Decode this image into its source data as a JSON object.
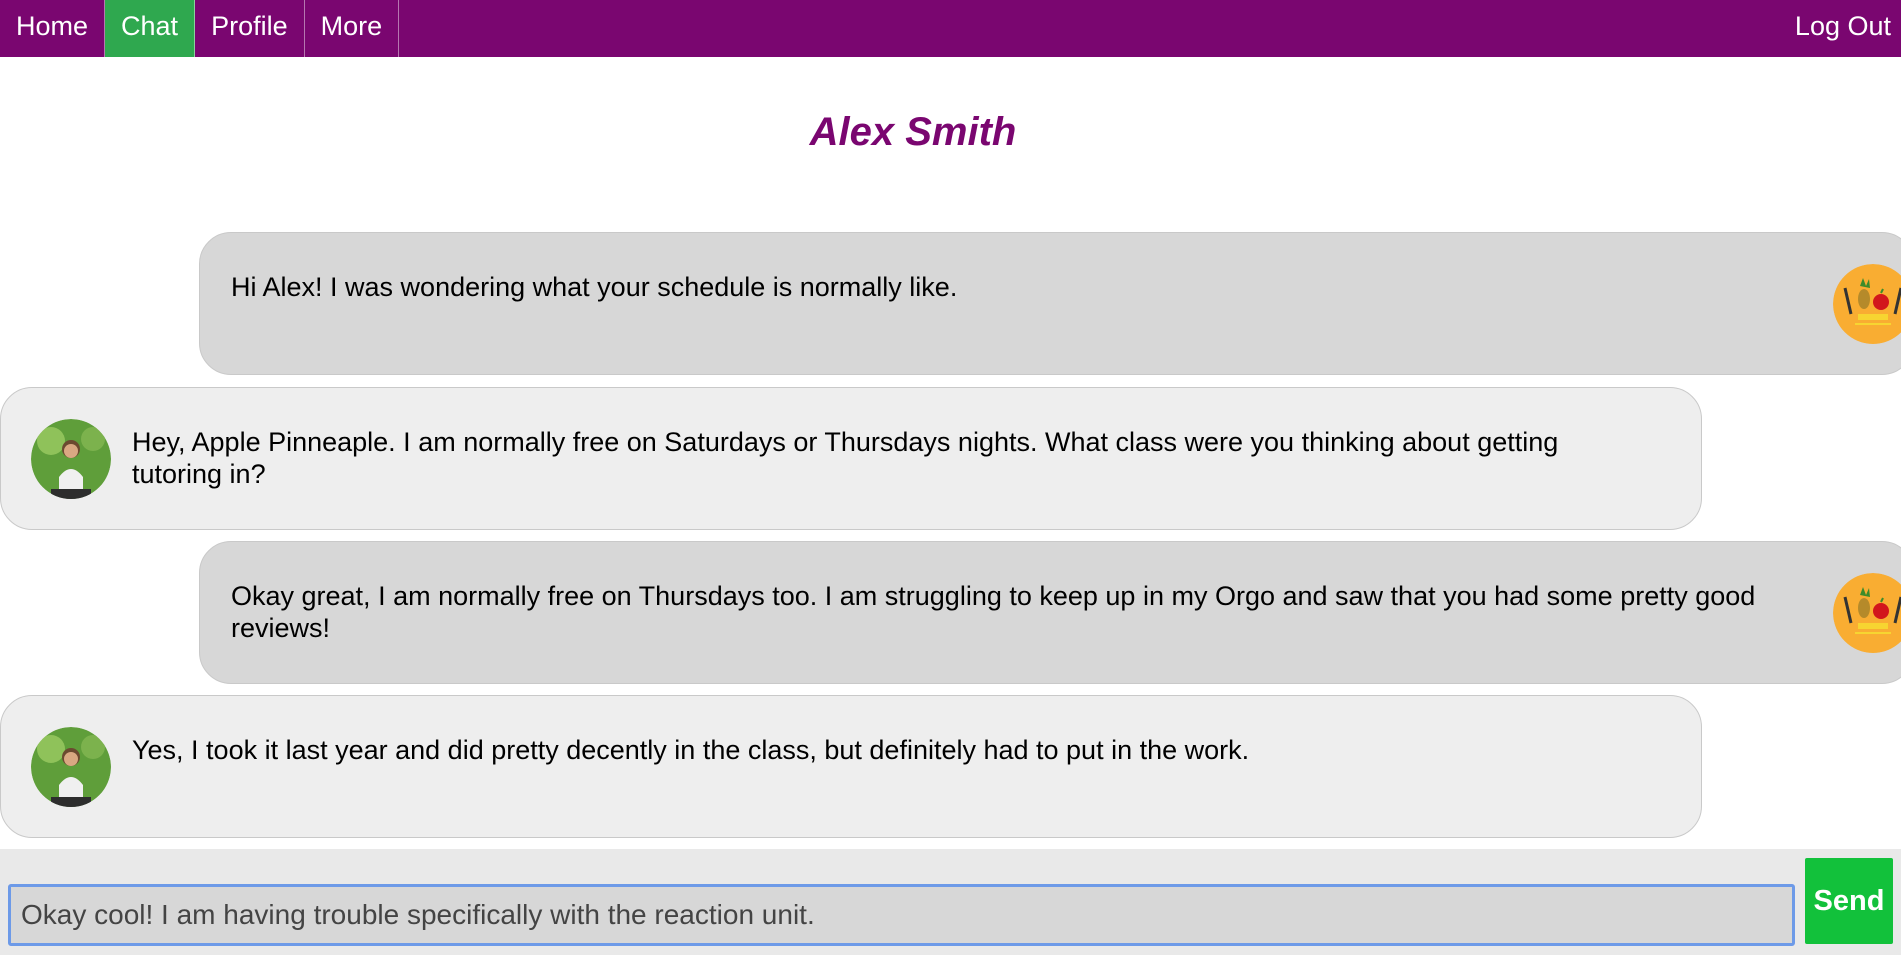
{
  "nav": {
    "items": [
      {
        "label": "Home",
        "active": false
      },
      {
        "label": "Chat",
        "active": true
      },
      {
        "label": "Profile",
        "active": false
      },
      {
        "label": "More",
        "active": false
      }
    ],
    "logout_label": "Log Out"
  },
  "chat": {
    "partner_name": "Alex Smith",
    "messages": [
      {
        "from": "me",
        "avatar": "ppap-logo-avatar",
        "text": "Hi Alex! I was wondering what your schedule is normally like."
      },
      {
        "from": "partner",
        "avatar": "tutor-photo-avatar",
        "text": "Hey, Apple Pinneaple. I am normally free on Saturdays or Thursdays nights. What class were you thinking about getting tutoring in?"
      },
      {
        "from": "me",
        "avatar": "ppap-logo-avatar",
        "text": "Okay great, I am normally free on Thursdays too. I am struggling to keep up in my Orgo and saw that you had some pretty good reviews!"
      },
      {
        "from": "partner",
        "avatar": "tutor-photo-avatar",
        "text": "Yes, I took it last year and did pretty decently in the class, but definitely had to put in the work."
      }
    ]
  },
  "composer": {
    "input_value": "Okay cool! I am having trouble specifically with the reaction unit.",
    "send_label": "Send"
  },
  "colors": {
    "nav_bg": "#7a0670",
    "nav_active": "#2fa84f",
    "title": "#7a0670",
    "sent_bubble": "#d7d7d7",
    "received_bubble": "#eeeeee",
    "send_button": "#12c13b",
    "input_focus_border": "#6d9ae8"
  }
}
